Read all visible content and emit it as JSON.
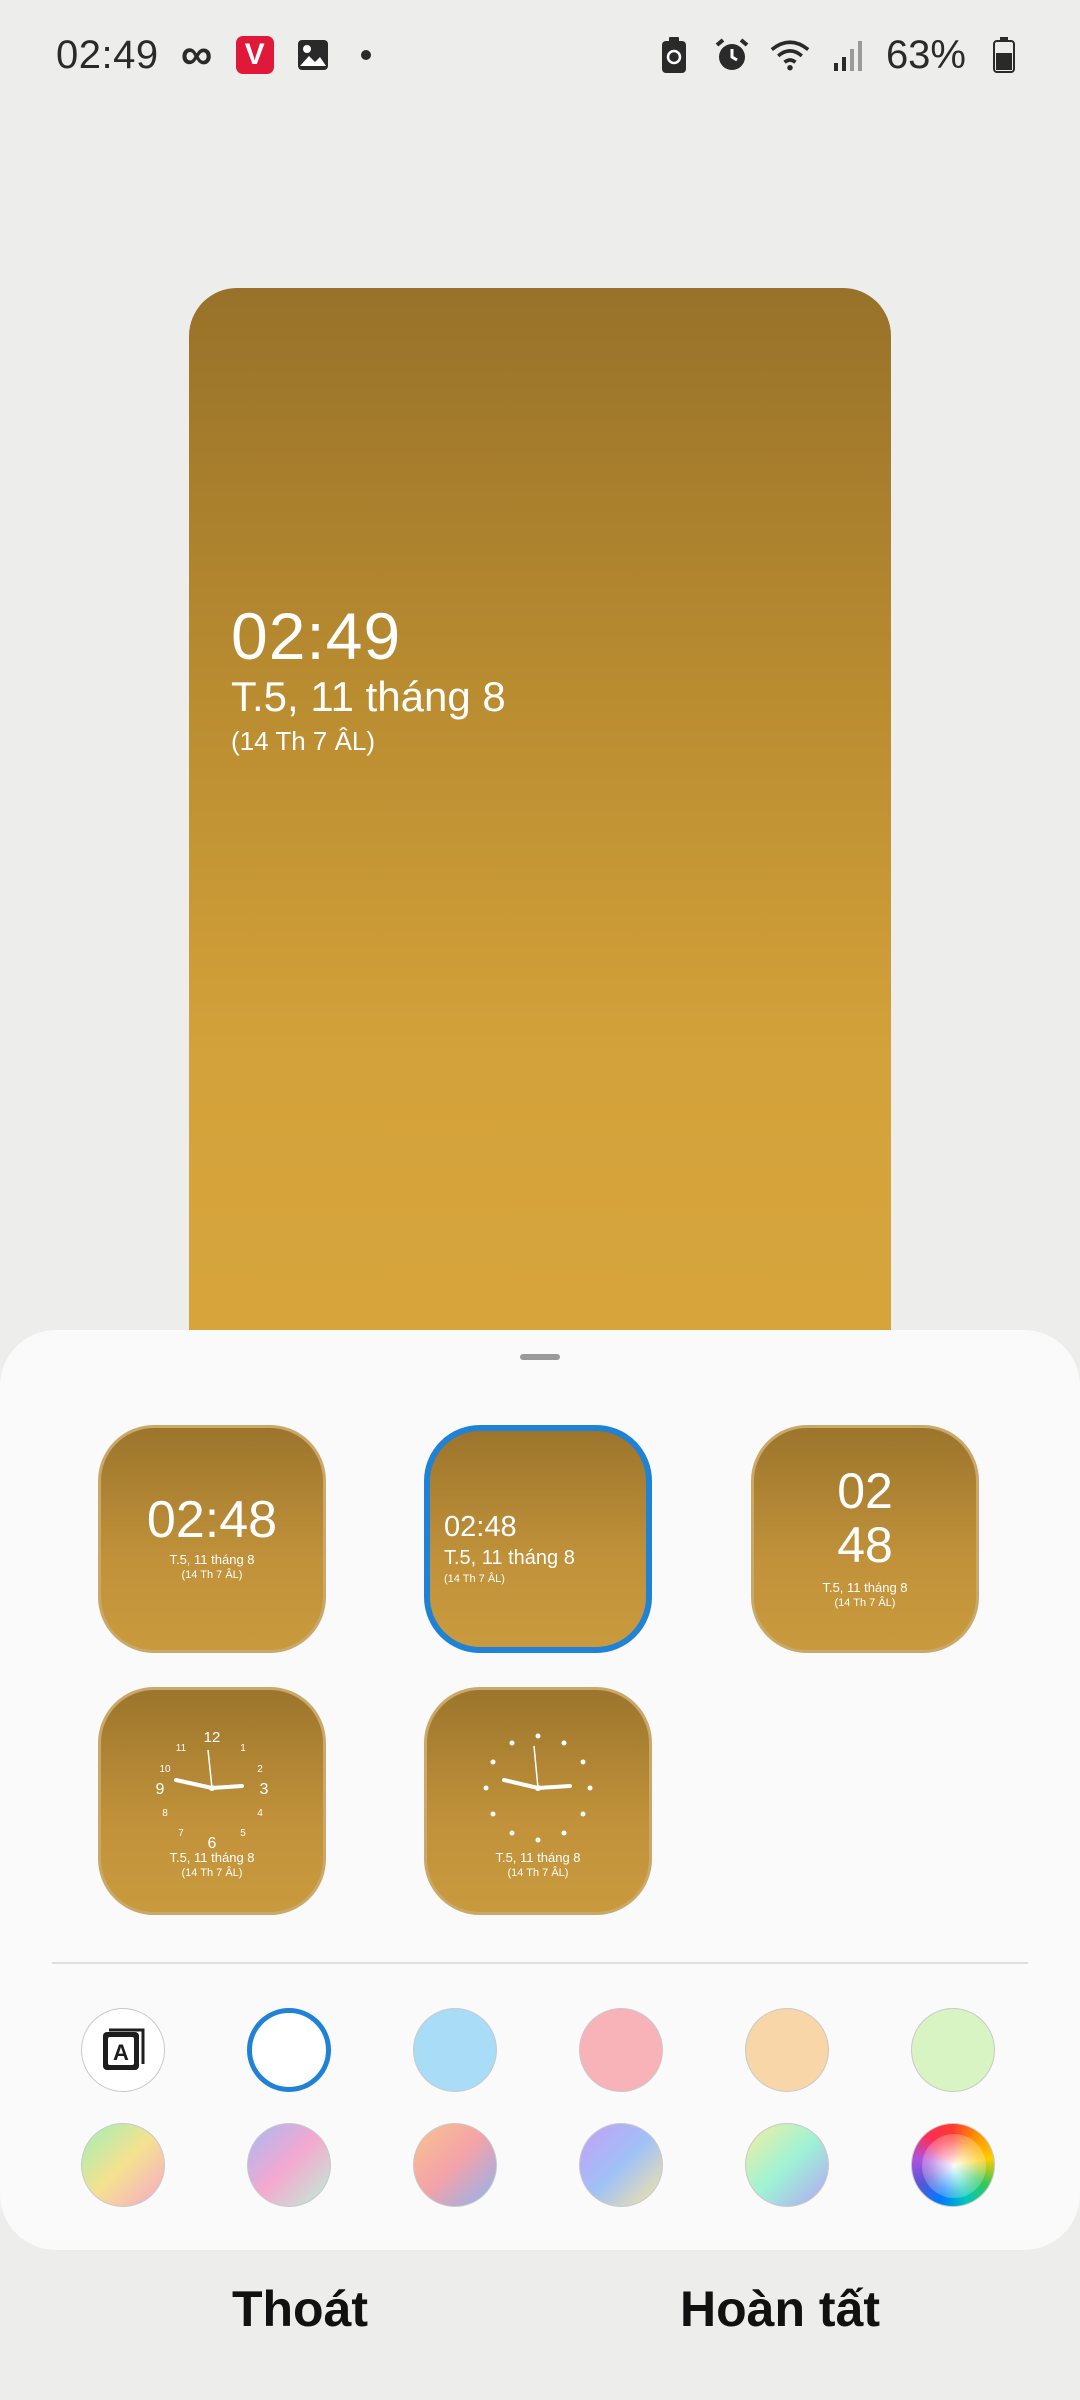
{
  "status_bar": {
    "time": "02:49",
    "battery_percent": "63%",
    "icons": [
      "infinity-icon",
      "v-app-icon",
      "gallery-icon",
      "notification-dot",
      "battery-saver-icon",
      "alarm-icon",
      "wifi-icon",
      "signal-icon",
      "battery-icon"
    ]
  },
  "preview": {
    "time": "02:49",
    "date": "T.5, 11 tháng 8",
    "lunar": "(14 Th 7 ÂL)"
  },
  "styles": [
    {
      "id": "digital-large",
      "time": "02:48",
      "date": "T.5, 11 tháng 8",
      "lunar": "(14 Th 7 ÂL)",
      "selected": false
    },
    {
      "id": "digital-left",
      "time": "02:48",
      "date": "T.5, 11 tháng 8",
      "lunar": "(14 Th 7 ÂL)",
      "selected": true
    },
    {
      "id": "digital-stacked",
      "hours": "02",
      "minutes": "48",
      "date": "T.5, 11 tháng 8",
      "lunar": "(14 Th 7 ÂL)",
      "selected": false
    },
    {
      "id": "analog-numbers",
      "date": "T.5, 11 tháng 8",
      "lunar": "(14 Th 7 ÂL)",
      "selected": false
    },
    {
      "id": "analog-dots",
      "date": "T.5, 11 tháng 8",
      "lunar": "(14 Th 7 ÂL)",
      "selected": false
    }
  ],
  "colors": {
    "accent": "#1f82d6",
    "solid": [
      "#ffffff",
      "#a8dcf7",
      "#f7b3b8",
      "#f8d6a8",
      "#d9f4c3"
    ],
    "gradients": [
      "mint-pink",
      "lilac-mint",
      "peach-blue",
      "violet-yellow",
      "green-violet",
      "rainbow-wheel"
    ]
  },
  "footer": {
    "exit_label": "Thoát",
    "done_label": "Hoàn tất"
  }
}
